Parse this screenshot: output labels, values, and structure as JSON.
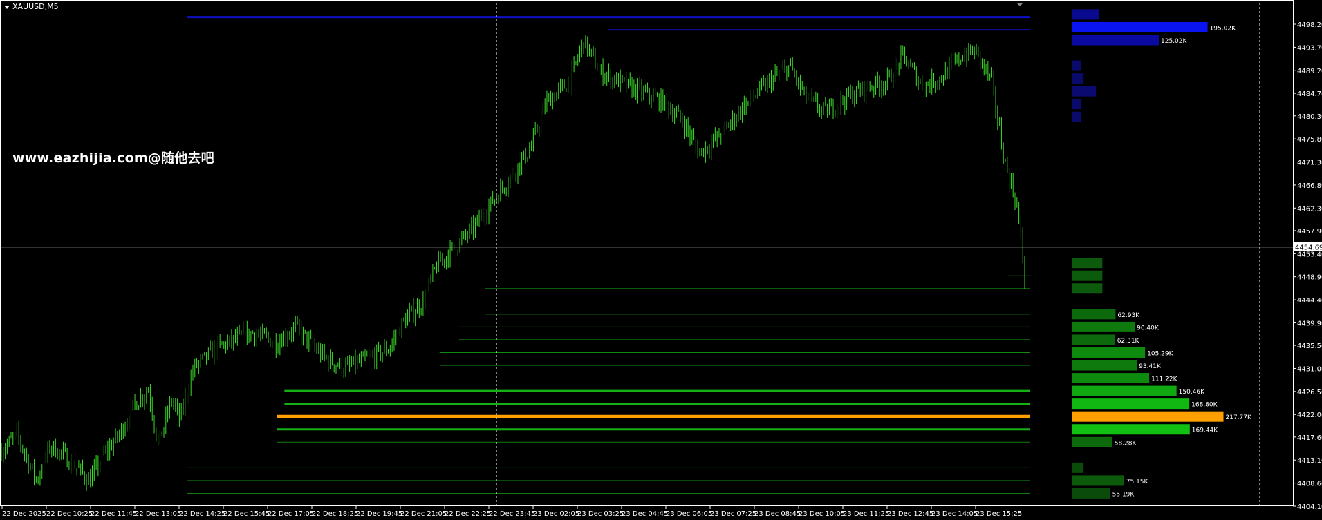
{
  "symbol_label": "XAUUSD,M5",
  "watermark": "www.eazhijia.com@随他去吧",
  "colors": {
    "background": "#000000",
    "candle": "#3ddc2a",
    "grid_text": "#ffffff",
    "axis_line": "#ffffff",
    "poc": "#ffa000",
    "resistance": "#1010c8",
    "support": "#0e8a0e"
  },
  "chart_data": {
    "type": "ohlc",
    "title": "",
    "y_axis": {
      "min": 4404.1,
      "max": 4500.5,
      "ticks": [
        "4498.20",
        "4493.70",
        "4489.20",
        "4484.70",
        "4480.30",
        "4475.80",
        "4471.30",
        "4466.80",
        "4462.30",
        "4457.90",
        "4453.40",
        "4448.90",
        "4444.40",
        "4439.90",
        "4435.50",
        "4431.00",
        "4426.50",
        "4422.00",
        "4417.60",
        "4413.10",
        "4408.60",
        "4404.10"
      ]
    },
    "current_price": "4454.69",
    "x_axis": {
      "ticks": [
        "22 Dec 2025",
        "22 Dec 10:25",
        "22 Dec 11:45",
        "22 Dec 13:05",
        "22 Dec 14:25",
        "22 Dec 15:45",
        "22 Dec 17:05",
        "22 Dec 18:25",
        "22 Dec 19:45",
        "22 Dec 21:05",
        "22 Dec 22:25",
        "22 Dec 23:45",
        "23 Dec 02:05",
        "23 Dec 03:25",
        "23 Dec 04:45",
        "23 Dec 06:05",
        "23 Dec 07:25",
        "23 Dec 08:45",
        "23 Dec 10:05",
        "23 Dec 11:25",
        "23 Dec 12:45",
        "23 Dec 14:05",
        "23 Dec 15:25"
      ]
    },
    "price_path": [
      [
        0,
        4415
      ],
      [
        8,
        4418
      ],
      [
        18,
        4409
      ],
      [
        25,
        4416
      ],
      [
        35,
        4413
      ],
      [
        45,
        4409
      ],
      [
        52,
        4414
      ],
      [
        60,
        4418
      ],
      [
        68,
        4424
      ],
      [
        75,
        4427
      ],
      [
        80,
        4416
      ],
      [
        87,
        4425
      ],
      [
        91,
        4421
      ],
      [
        98,
        4431
      ],
      [
        110,
        4435
      ],
      [
        128,
        4438
      ],
      [
        140,
        4436
      ],
      [
        150,
        4439
      ],
      [
        165,
        4433
      ],
      [
        175,
        4431
      ],
      [
        188,
        4433
      ],
      [
        198,
        4435
      ],
      [
        205,
        4440
      ],
      [
        215,
        4444
      ],
      [
        222,
        4451
      ],
      [
        240,
        4458
      ],
      [
        255,
        4466
      ],
      [
        270,
        4474
      ],
      [
        278,
        4483
      ],
      [
        290,
        4487
      ],
      [
        297,
        4495
      ],
      [
        305,
        4489
      ],
      [
        320,
        4486
      ],
      [
        338,
        4483
      ],
      [
        348,
        4479
      ],
      [
        356,
        4473
      ],
      [
        368,
        4477
      ],
      [
        378,
        4482
      ],
      [
        392,
        4487
      ],
      [
        402,
        4490
      ],
      [
        410,
        4484
      ],
      [
        420,
        4481
      ],
      [
        432,
        4484
      ],
      [
        442,
        4486
      ],
      [
        452,
        4487
      ],
      [
        460,
        4492
      ],
      [
        470,
        4486
      ],
      [
        480,
        4488
      ],
      [
        490,
        4492
      ],
      [
        497,
        4493
      ],
      [
        505,
        4487
      ],
      [
        512,
        4471
      ],
      [
        518,
        4463
      ],
      [
        522,
        4449
      ]
    ],
    "candle_count": 530,
    "levels": [
      {
        "price": 4499.6,
        "color": "#1010c8",
        "width": 3,
        "from": 0.145
      },
      {
        "price": 4497.1,
        "color": "#1010a0",
        "width": 2,
        "from": 0.47
      },
      {
        "price": 4449.1,
        "color": "#0f7a0f",
        "width": 1,
        "from": 0.78
      },
      {
        "price": 4446.6,
        "color": "#0f7a0f",
        "width": 1,
        "from": 0.375
      },
      {
        "price": 4441.6,
        "color": "#0f7a0f",
        "width": 1,
        "from": 0.375
      },
      {
        "price": 4439.1,
        "color": "#0f8a0f",
        "width": 1,
        "from": 0.355
      },
      {
        "price": 4436.6,
        "color": "#0f8a0f",
        "width": 1,
        "from": 0.355
      },
      {
        "price": 4434.1,
        "color": "#0f8a0f",
        "width": 1,
        "from": 0.34
      },
      {
        "price": 4431.6,
        "color": "#0f8a0f",
        "width": 1,
        "from": 0.34
      },
      {
        "price": 4429.1,
        "color": "#0f8a0f",
        "width": 1,
        "from": 0.31
      },
      {
        "price": 4426.6,
        "color": "#16b016",
        "width": 3,
        "from": 0.22
      },
      {
        "price": 4424.1,
        "color": "#16b016",
        "width": 3,
        "from": 0.22
      },
      {
        "price": 4421.6,
        "color": "#ffa000",
        "width": 5,
        "from": 0.214
      },
      {
        "price": 4419.1,
        "color": "#16b016",
        "width": 3,
        "from": 0.214
      },
      {
        "price": 4416.6,
        "color": "#0f7a0f",
        "width": 1,
        "from": 0.214
      },
      {
        "price": 4411.6,
        "color": "#0f7a0f",
        "width": 1,
        "from": 0.145
      },
      {
        "price": 4409.1,
        "color": "#0f7a0f",
        "width": 1,
        "from": 0.145
      },
      {
        "price": 4406.6,
        "color": "#0f7a0f",
        "width": 1,
        "from": 0.145
      }
    ],
    "volume_profile": [
      {
        "price": 4500.1,
        "value": 39,
        "label": "",
        "color": "#0a0a90"
      },
      {
        "price": 4497.6,
        "value": 195.02,
        "label": "195.02K",
        "color": "#0a14f0"
      },
      {
        "price": 4495.1,
        "value": 125.02,
        "label": "125.02K",
        "color": "#0a0aa0"
      },
      {
        "price": 4490.1,
        "value": 14,
        "label": "",
        "color": "#0a0a6a"
      },
      {
        "price": 4487.6,
        "value": 17,
        "label": "",
        "color": "#0a0a6a"
      },
      {
        "price": 4485.1,
        "value": 35,
        "label": "",
        "color": "#0a0a70"
      },
      {
        "price": 4482.6,
        "value": 14,
        "label": "",
        "color": "#0a0a6a"
      },
      {
        "price": 4480.1,
        "value": 14,
        "label": "",
        "color": "#0a0a6a"
      },
      {
        "price": 4451.6,
        "value": 44,
        "label": "",
        "color": "#0c5a0c"
      },
      {
        "price": 4449.1,
        "value": 44,
        "label": "",
        "color": "#0c5a0c"
      },
      {
        "price": 4446.6,
        "value": 44,
        "label": "",
        "color": "#0c5a0c"
      },
      {
        "price": 4441.6,
        "value": 62.93,
        "label": "62.93K",
        "color": "#0c6a0c"
      },
      {
        "price": 4439.1,
        "value": 90.4,
        "label": "90.40K",
        "color": "#0e7a0e"
      },
      {
        "price": 4436.6,
        "value": 62.31,
        "label": "62.31K",
        "color": "#0c6a0c"
      },
      {
        "price": 4434.1,
        "value": 105.29,
        "label": "105.29K",
        "color": "#0e8a0e"
      },
      {
        "price": 4431.6,
        "value": 93.41,
        "label": "93.41K",
        "color": "#0e7a0e"
      },
      {
        "price": 4429.1,
        "value": 111.22,
        "label": "111.22K",
        "color": "#0e8a0e"
      },
      {
        "price": 4426.6,
        "value": 150.46,
        "label": "150.46K",
        "color": "#10a810"
      },
      {
        "price": 4424.1,
        "value": 168.8,
        "label": "168.80K",
        "color": "#12b812"
      },
      {
        "price": 4421.6,
        "value": 217.77,
        "label": "217.77K",
        "color": "#ffa000"
      },
      {
        "price": 4419.1,
        "value": 169.44,
        "label": "169.44K",
        "color": "#12c012"
      },
      {
        "price": 4416.6,
        "value": 58.28,
        "label": "58.28K",
        "color": "#0c6a0c"
      },
      {
        "price": 4411.6,
        "value": 17,
        "label": "",
        "color": "#0a4a0a"
      },
      {
        "price": 4409.1,
        "value": 75.15,
        "label": "75.15K",
        "color": "#0c5a0c"
      },
      {
        "price": 4406.6,
        "value": 55.19,
        "label": "55.19K",
        "color": "#0a4a0a"
      }
    ]
  }
}
